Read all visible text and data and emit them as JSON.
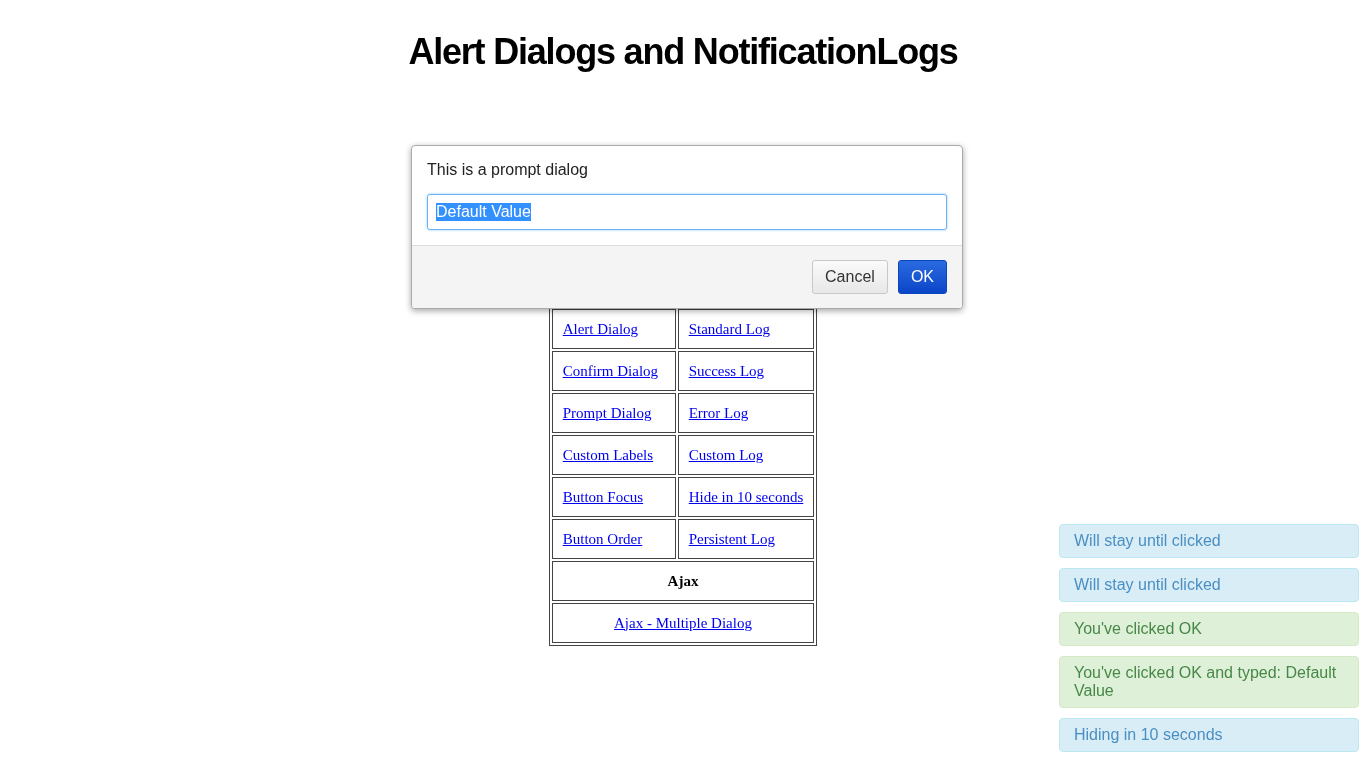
{
  "heading": "Alert Dialogs and NotificationLogs",
  "table": {
    "rows": [
      {
        "kind": "pair",
        "cells": [
          "Alert Dialog",
          "Standard Log"
        ]
      },
      {
        "kind": "pair",
        "cells": [
          "Confirm Dialog",
          "Success Log"
        ]
      },
      {
        "kind": "pair",
        "cells": [
          "Prompt Dialog",
          "Error Log"
        ]
      },
      {
        "kind": "pair",
        "cells": [
          "Custom Labels",
          "Custom Log"
        ]
      },
      {
        "kind": "pair",
        "cells": [
          "Button Focus",
          "Hide in 10 seconds"
        ]
      },
      {
        "kind": "pair",
        "cells": [
          "Button Order",
          "Persistent Log"
        ]
      },
      {
        "kind": "heading",
        "cells": [
          {
            "text": "Ajax",
            "colspan": 2
          }
        ]
      },
      {
        "kind": "link",
        "cells": [
          {
            "text": "Ajax - Multiple Dialog",
            "colspan": 2
          }
        ]
      }
    ]
  },
  "dialog": {
    "message": "This is a prompt dialog",
    "input": {
      "value": "Default Value",
      "value_selected": true
    },
    "buttons": [
      {
        "label": "Cancel",
        "kind": "secondary"
      },
      {
        "label": "OK",
        "kind": "primary"
      }
    ]
  },
  "logs": [
    {
      "text": "Will stay until clicked",
      "kind": "info"
    },
    {
      "text": "Will stay until clicked",
      "kind": "info"
    },
    {
      "text": "You've clicked OK",
      "kind": "success"
    },
    {
      "text": "You've clicked OK and typed: Default Value",
      "kind": "success"
    },
    {
      "text": "Hiding in 10 seconds",
      "kind": "info"
    }
  ]
}
